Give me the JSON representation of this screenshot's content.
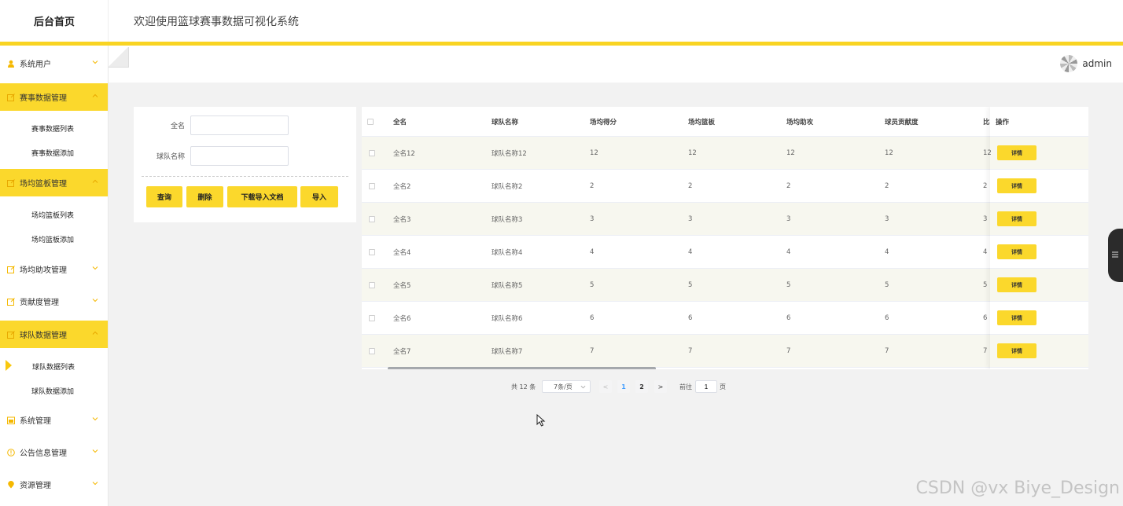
{
  "header": {
    "brand": "后台首页",
    "welcome": "欢迎使用篮球赛事数据可视化系统"
  },
  "colors": {
    "accent": "#fbd82c",
    "accent_bar": "#f9d423"
  },
  "sidebar": {
    "items": [
      {
        "label": "系统用户",
        "icon": "user-icon",
        "expanded": false
      },
      {
        "label": "赛事数据管理",
        "icon": "edit-icon",
        "expanded": true,
        "children": [
          "赛事数据列表",
          "赛事数据添加"
        ]
      },
      {
        "label": "场均篮板管理",
        "icon": "edit-icon",
        "expanded": true,
        "children": [
          "场均篮板列表",
          "场均篮板添加"
        ]
      },
      {
        "label": "场均助攻管理",
        "icon": "edit-icon",
        "expanded": false
      },
      {
        "label": "贡献度管理",
        "icon": "edit-icon",
        "expanded": false
      },
      {
        "label": "球队数据管理",
        "icon": "edit-icon",
        "expanded": true,
        "children": [
          "球队数据列表",
          "球队数据添加"
        ],
        "selected_child": "球队数据列表"
      },
      {
        "label": "系统管理",
        "icon": "calendar-icon",
        "expanded": false
      },
      {
        "label": "公告信息管理",
        "icon": "info-icon",
        "expanded": false
      },
      {
        "label": "资源管理",
        "icon": "location-icon",
        "expanded": false
      }
    ]
  },
  "user": {
    "name": "admin"
  },
  "search": {
    "fields": [
      {
        "label": "全名",
        "value": ""
      },
      {
        "label": "球队名称",
        "value": ""
      }
    ],
    "buttons": [
      "查询",
      "删除",
      "下载导入文档",
      "导入"
    ]
  },
  "table": {
    "columns": [
      "全名",
      "球队名称",
      "场均得分",
      "场均篮板",
      "场均助攻",
      "球员贡献度",
      "比"
    ],
    "op_header": "操作",
    "detail_label": "详情",
    "rows": [
      [
        "全名12",
        "球队名称12",
        "12",
        "12",
        "12",
        "12",
        "12"
      ],
      [
        "全名2",
        "球队名称2",
        "2",
        "2",
        "2",
        "2",
        "2"
      ],
      [
        "全名3",
        "球队名称3",
        "3",
        "3",
        "3",
        "3",
        "3"
      ],
      [
        "全名4",
        "球队名称4",
        "4",
        "4",
        "4",
        "4",
        "4"
      ],
      [
        "全名5",
        "球队名称5",
        "5",
        "5",
        "5",
        "5",
        "5"
      ],
      [
        "全名6",
        "球队名称6",
        "6",
        "6",
        "6",
        "6",
        "6"
      ],
      [
        "全名7",
        "球队名称7",
        "7",
        "7",
        "7",
        "7",
        "7"
      ]
    ]
  },
  "pagination": {
    "total": "共 12 条",
    "page_size": "7条/页",
    "prev": "<",
    "pages": [
      "1",
      "2"
    ],
    "current": "1",
    "next": ">",
    "goto_label": "前往",
    "goto_value": "1",
    "goto_suffix": "页"
  },
  "watermark": "CSDN @vx  Biye_Design"
}
